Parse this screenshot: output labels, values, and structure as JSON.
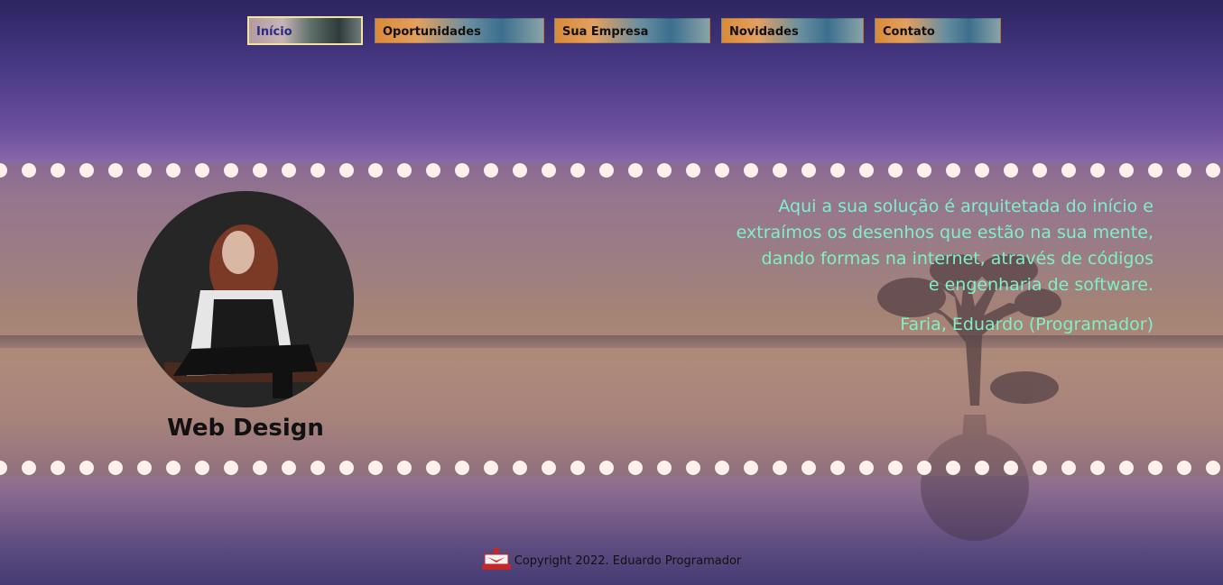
{
  "nav": {
    "items": [
      {
        "label": "Início",
        "active": true
      },
      {
        "label": "Oportunidades"
      },
      {
        "label": "Sua Empresa"
      },
      {
        "label": "Novidades"
      },
      {
        "label": "Contato"
      }
    ]
  },
  "hero": {
    "caption": "Web Design",
    "quote_lines": [
      "Aqui a sua solução é arquitetada do início e",
      "extraímos os desenhos que estão na sua mente,",
      "dando formas na internet, através de códigos",
      "e engenharia de software."
    ],
    "author": "Faria, Eduardo (Programador)"
  },
  "footer": {
    "text": "Copyright 2022. Eduardo Programador"
  },
  "colors": {
    "quote": "#7ff0c8",
    "dots": "#fff0ea",
    "active_border": "#f3e3a0"
  }
}
